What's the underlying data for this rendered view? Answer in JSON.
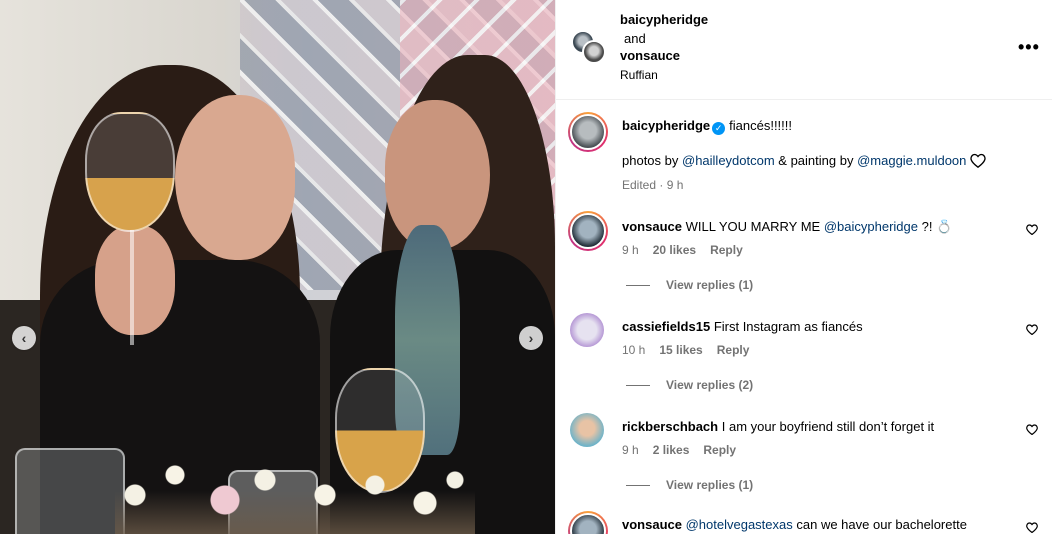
{
  "header": {
    "user1": "baicypheridge",
    "conjunction": "and",
    "user2": "vonsauce",
    "location": "Ruffian"
  },
  "caption": {
    "username": "baicypheridge",
    "text": "fiancés!!!!!!",
    "line2_prefix": "photos by ",
    "mention1": "@hailleydotcom",
    "line2_middle": " & painting by ",
    "mention2": "@maggie.muldoon",
    "meta": "Edited · 9 h"
  },
  "comments": [
    {
      "username": "vonsauce",
      "text_prefix": "WILL YOU MARRY ME ",
      "mention": "@baicypheridge",
      "text_suffix": " ?! 💍",
      "time": "9 h",
      "likes": "20 likes",
      "reply": "Reply",
      "view_replies": "View replies (1)"
    },
    {
      "username": "cassiefields15",
      "text": "First Instagram as fiancés",
      "time": "10 h",
      "likes": "15 likes",
      "reply": "Reply",
      "view_replies": "View replies (2)"
    },
    {
      "username": "rickberschbach",
      "text": "I am your boyfriend still don’t forget it",
      "time": "9 h",
      "likes": "2 likes",
      "reply": "Reply",
      "view_replies": "View replies (1)"
    },
    {
      "username": "vonsauce",
      "mention": "@hotelvegastexas",
      "text": " can we have our bachelorette"
    }
  ],
  "icons": {
    "more": "more-options-icon",
    "heart": "heart-icon",
    "prev": "chevron-left-icon",
    "next": "chevron-right-icon"
  },
  "colors": {
    "link": "#00376b",
    "verified": "#0095f6",
    "meta": "#737373"
  }
}
